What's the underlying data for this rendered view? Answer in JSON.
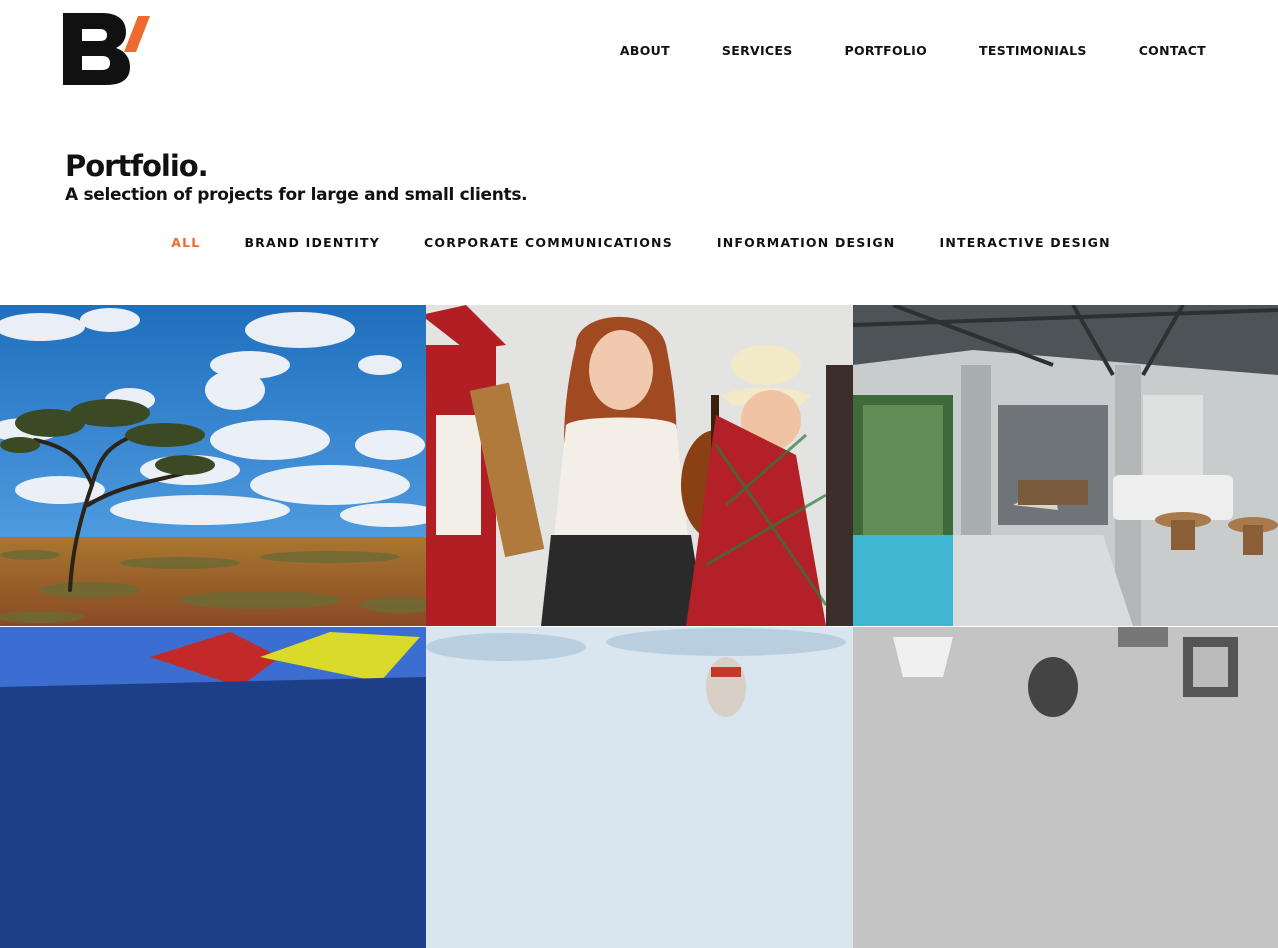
{
  "brand": {
    "logo_icon": "b-slash-logo-icon",
    "accent_color": "#ee6a2f"
  },
  "nav": {
    "items": [
      {
        "label": "ABOUT"
      },
      {
        "label": "SERVICES"
      },
      {
        "label": "PORTFOLIO"
      },
      {
        "label": "TESTIMONIALS"
      },
      {
        "label": "CONTACT"
      }
    ]
  },
  "intro": {
    "title": "Portfolio.",
    "subtitle": "A selection of projects for large and small clients."
  },
  "filters": {
    "items": [
      {
        "label": "ALL",
        "active": true
      },
      {
        "label": "BRAND IDENTITY"
      },
      {
        "label": "CORPORATE COMMUNICATIONS"
      },
      {
        "label": "INFORMATION DESIGN"
      },
      {
        "label": "INTERACTIVE DESIGN"
      }
    ]
  },
  "portfolio": {
    "tiles": [
      {
        "subject": "outback-landscape"
      },
      {
        "subject": "musicians-portrait"
      },
      {
        "subject": "villa-pool-interior"
      },
      {
        "subject": "colorful-vehicle"
      },
      {
        "subject": "sky-scene"
      },
      {
        "subject": "black-and-white-interior"
      }
    ]
  }
}
